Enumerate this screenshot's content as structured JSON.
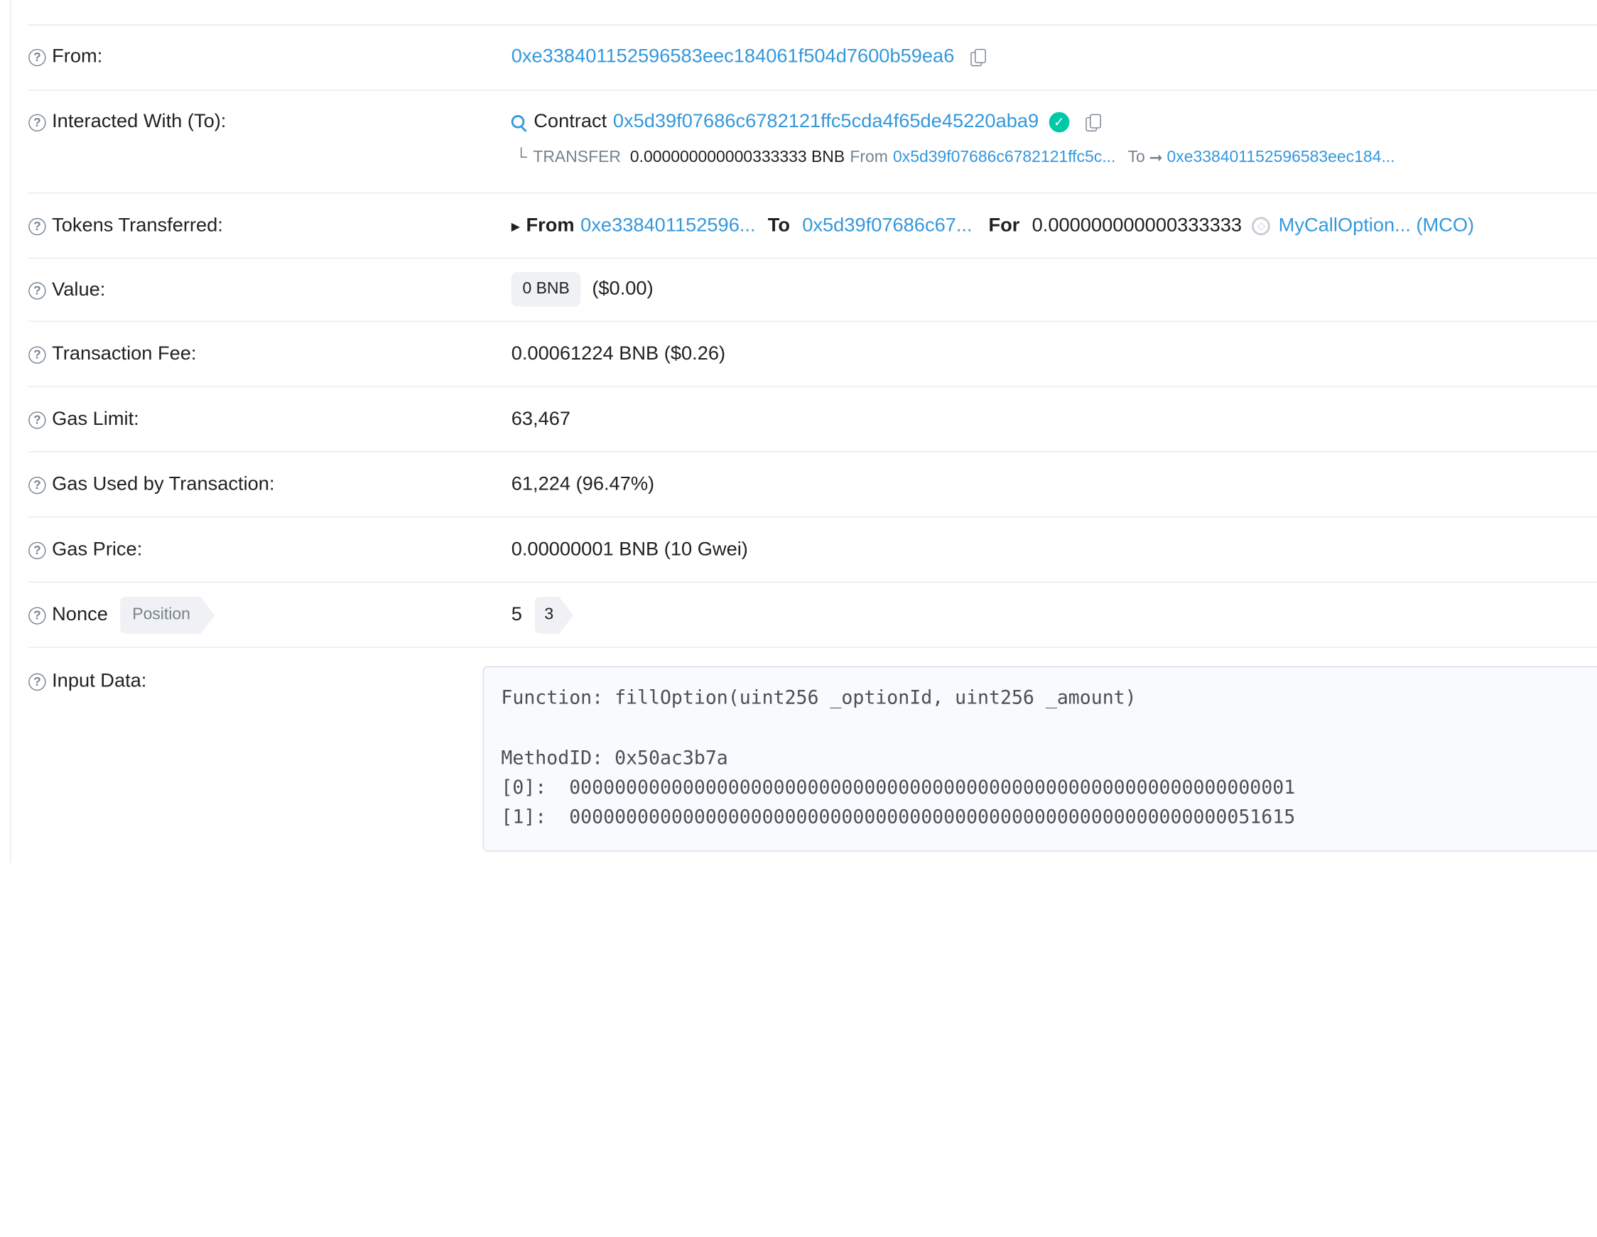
{
  "rows": {
    "from": {
      "label": "From:",
      "address": "0xe338401152596583eec184061f504d7600b59ea6"
    },
    "interacted": {
      "label": "Interacted With (To):",
      "contract_word": "Contract",
      "address": "0x5d39f07686c6782121ffc5cda4f65de45220aba9",
      "transfer_prefix": "TRANSFER",
      "transfer_amount": "0.000000000000333333 BNB",
      "from_word": "From",
      "from_addr": "0x5d39f07686c6782121ffc5c...",
      "to_word": "To",
      "to_addr": "0xe338401152596583eec184..."
    },
    "tokens": {
      "label": "Tokens Transferred:",
      "from_word": "From",
      "from_addr": "0xe338401152596...",
      "to_word": "To",
      "to_addr": "0x5d39f07686c67...",
      "for_word": "For",
      "amount": "0.000000000000333333",
      "token": "MyCallOption... (MCO)"
    },
    "value": {
      "label": "Value:",
      "badge": "0 BNB",
      "usd": "($0.00)"
    },
    "fee": {
      "label": "Transaction Fee:",
      "value": "0.00061224 BNB ($0.26)"
    },
    "gas_limit": {
      "label": "Gas Limit:",
      "value": "63,467"
    },
    "gas_used": {
      "label": "Gas Used by Transaction:",
      "value": "61,224 (96.47%)"
    },
    "gas_price": {
      "label": "Gas Price:",
      "value": "0.00000001 BNB (10 Gwei)"
    },
    "nonce": {
      "label": "Nonce",
      "position_label": "Position",
      "value": "5",
      "position_value": "3"
    },
    "input": {
      "label": "Input Data:",
      "lines": [
        "Function: fillOption(uint256 _optionId, uint256 _amount)",
        "MethodID: 0x50ac3b7a",
        "[0]:  0000000000000000000000000000000000000000000000000000000000000001",
        "[1]:  0000000000000000000000000000000000000000000000000000000000051615"
      ]
    }
  },
  "colors": {
    "link": "#3498db",
    "verified": "#00c9a7"
  }
}
